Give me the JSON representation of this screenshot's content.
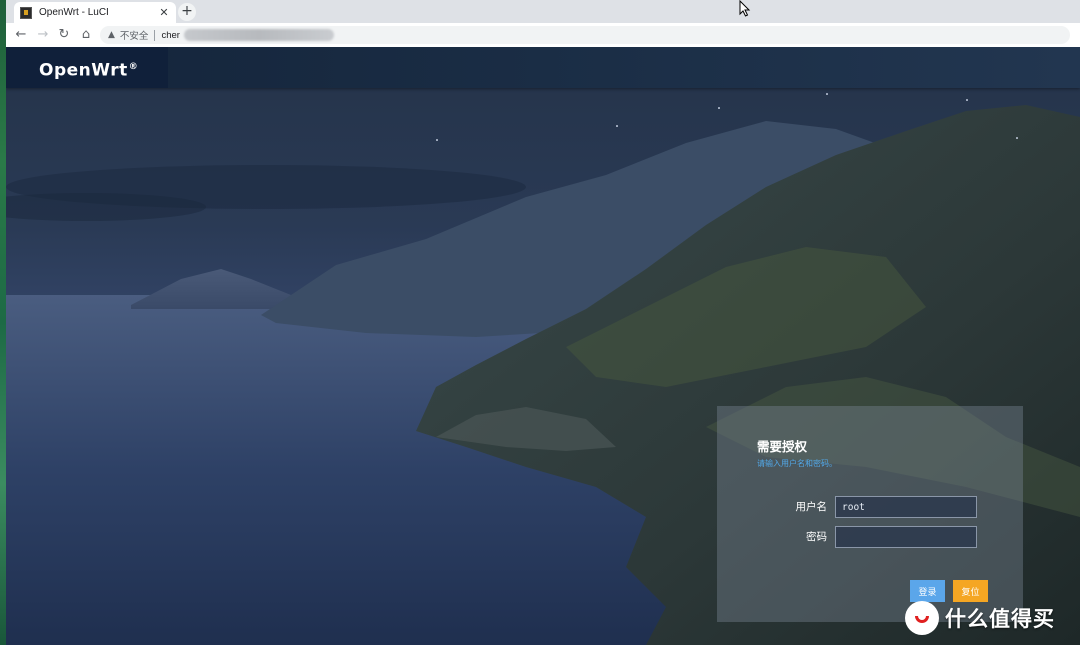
{
  "browser": {
    "tab_title": "OpenWrt - LuCI",
    "tab_close": "✕",
    "new_tab": "+",
    "security_text": "不安全",
    "url_visible": "cher"
  },
  "header": {
    "brand": "OpenWrt",
    "brand_mark": "®"
  },
  "login": {
    "title": "需要授权",
    "hint": "请输入用户名和密码。",
    "username_label": "用户名",
    "username_value": "root",
    "password_label": "密码",
    "password_value": "",
    "login_button": "登录",
    "reset_button": "复位"
  },
  "watermark": {
    "text": "什么值得买"
  },
  "colors": {
    "header_bg": "#1a2d45",
    "hint": "#52a8e8",
    "login_button": "#5ba6ea",
    "reset_button": "#f5a623"
  }
}
